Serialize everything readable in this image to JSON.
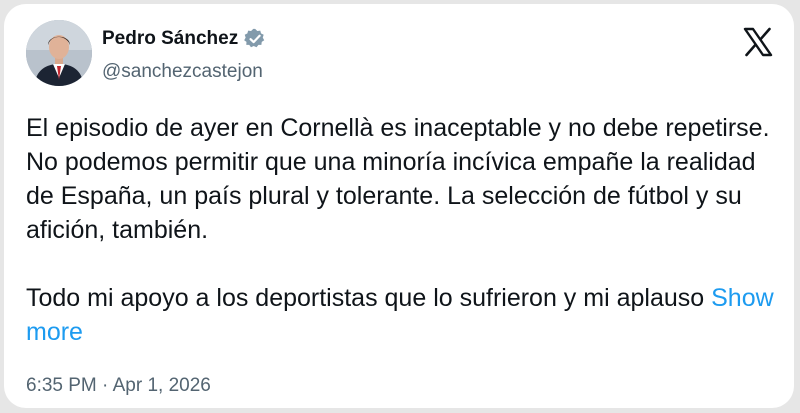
{
  "author": {
    "name": "Pedro Sánchez",
    "handle": "@sanchezcastejon",
    "verified": true
  },
  "tweet": {
    "paragraph_1": "El episodio de ayer en Cornellà es inaceptable y no debe repetirse. No podemos permitir que una minoría incívica empañe la realidad de España, un país plural y tolerante. La selección de fútbol y su afición, también.",
    "paragraph_2": "Todo mi apoyo a los deportistas que lo sufrieron y mi aplauso",
    "show_more_label": "Show more",
    "timestamp": "6:35 PM · Apr 1, 2026"
  },
  "icons": {
    "brand": "x-logo-icon",
    "verified": "verified-badge-icon",
    "avatar": "avatar"
  },
  "colors": {
    "link": "#1d9bf0",
    "verified_badge": "#829aab",
    "text_primary": "#0f1419",
    "text_secondary": "#536471"
  }
}
